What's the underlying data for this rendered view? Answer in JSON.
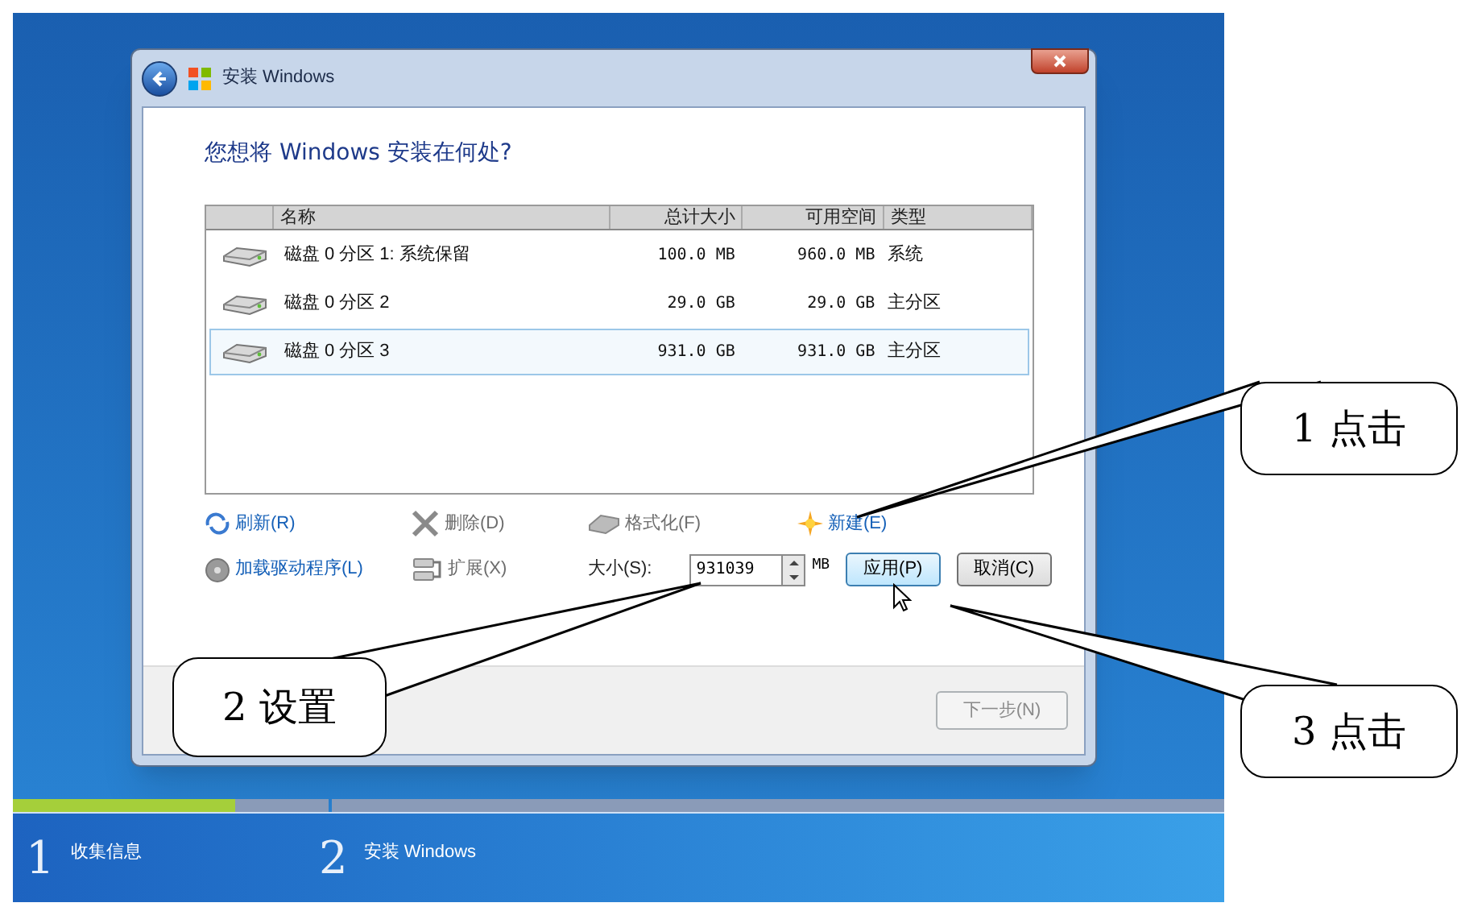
{
  "window": {
    "title": "安装 Windows",
    "heading": "您想将 Windows 安装在何处?",
    "table": {
      "columns": [
        "名称",
        "总计大小",
        "可用空间",
        "类型"
      ],
      "rows": [
        {
          "name": "磁盘 0 分区 1: 系统保留",
          "total": "100.0 MB",
          "free": "960.0 MB",
          "type": "系统",
          "selected": false
        },
        {
          "name": "磁盘 0 分区 2",
          "total": "29.0 GB",
          "free": "29.0 GB",
          "type": "主分区",
          "selected": false
        },
        {
          "name": "磁盘 0 分区 3",
          "total": "931.0 GB",
          "free": "931.0 GB",
          "type": "主分区",
          "selected": true
        }
      ]
    },
    "actions": [
      {
        "kind": "refresh",
        "label": "刷新(R)",
        "disabled": false
      },
      {
        "kind": "delete",
        "label": "删除(D)",
        "disabled": true
      },
      {
        "kind": "format",
        "label": "格式化(F)",
        "disabled": true
      },
      {
        "kind": "new",
        "label": "新建(E)",
        "disabled": false
      },
      {
        "kind": "driver",
        "label": "加载驱动程序(L)",
        "disabled": false
      },
      {
        "kind": "extend",
        "label": "扩展(X)",
        "disabled": true
      }
    ],
    "size": {
      "label": "大小(S):",
      "value": "931039",
      "unit": "MB"
    },
    "buttons": [
      {
        "label": "应用(P)",
        "focused": true
      },
      {
        "label": "取消(C)",
        "focused": false
      }
    ],
    "next_button": {
      "label": "下一步(N)",
      "disabled": true
    }
  },
  "steps": [
    {
      "number": "1",
      "label": "收集信息",
      "level": 0.7
    },
    {
      "number": "2",
      "label": "安装 Windows",
      "level": 0
    }
  ],
  "callouts": [
    {
      "text": "1 点击"
    },
    {
      "text": "2 设置"
    },
    {
      "text": "3 点击"
    }
  ]
}
